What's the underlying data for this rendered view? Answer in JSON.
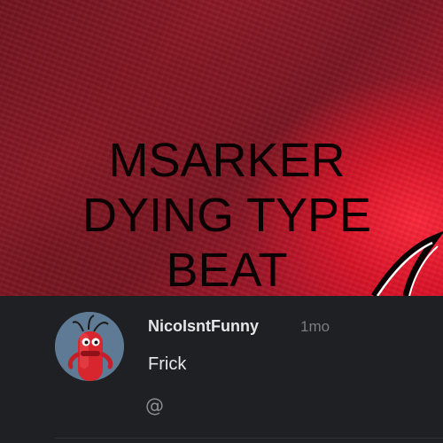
{
  "artwork": {
    "title": "MSARKER\nDYING TYPE\nBEAT"
  },
  "comment": {
    "username": "NicoIsntFunny",
    "timestamp": "1mo",
    "text": "Frick",
    "mention_symbol": "@"
  },
  "colors": {
    "background": "#1e2023",
    "username": "#e6e6e6",
    "timestamp": "#7a7d82",
    "artwork_accent": "#c0102a"
  },
  "icons": {
    "avatar": "red-character-avatar",
    "mention": "at-sign-icon"
  }
}
